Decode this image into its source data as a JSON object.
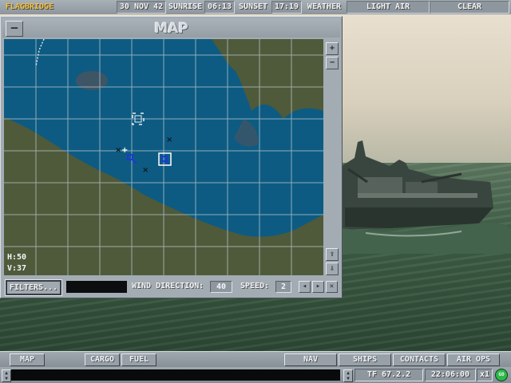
{
  "topbar": {
    "brand": "FLAGBRIDGE",
    "date": "30 NOV 42",
    "sunrise_label": "SUNRISE",
    "sunrise_time": "06:13",
    "sunset_label": "SUNSET",
    "sunset_time": "17:19",
    "weather_label": "WEATHER",
    "wind_condition": "LIGHT AIR",
    "sky_condition": "CLEAR"
  },
  "map_window": {
    "title": "MAP",
    "close_glyph": "—",
    "zoom_in": "+",
    "zoom_out": "−",
    "scroll_up": "⇧",
    "scroll_down": "⇩",
    "h_readout": "H:50",
    "v_readout": "V:37",
    "filters_label": "FILTERS...",
    "wind_direction_label": "WIND DIRECTION:",
    "wind_direction_value": "40",
    "speed_label": "SPEED:",
    "speed_value": "2",
    "speed_prev": "◂",
    "speed_next": "▸",
    "speed_close": "✕"
  },
  "navbar": {
    "map": "MAP",
    "cargo": "CARGO",
    "fuel": "FUEL",
    "nav": "NAV",
    "ships": "SHIPS",
    "contacts": "CONTACTS",
    "air_ops": "AIR OPS"
  },
  "statusbar": {
    "task_force": "TF 67.2.2",
    "clock": "22:06:00",
    "time_compression": "x1",
    "go_label": "GO"
  },
  "colors": {
    "ocean": "#0d5b82",
    "land": "#4f5a3a",
    "accent_brand": "#f4c23a",
    "go_button": "#2fb84a"
  },
  "icons": {
    "map_close": "dash-icon",
    "selected_unit": "square-target-icon",
    "contact": "x-mark-icon",
    "bracket_marker": "bracket-icon"
  }
}
